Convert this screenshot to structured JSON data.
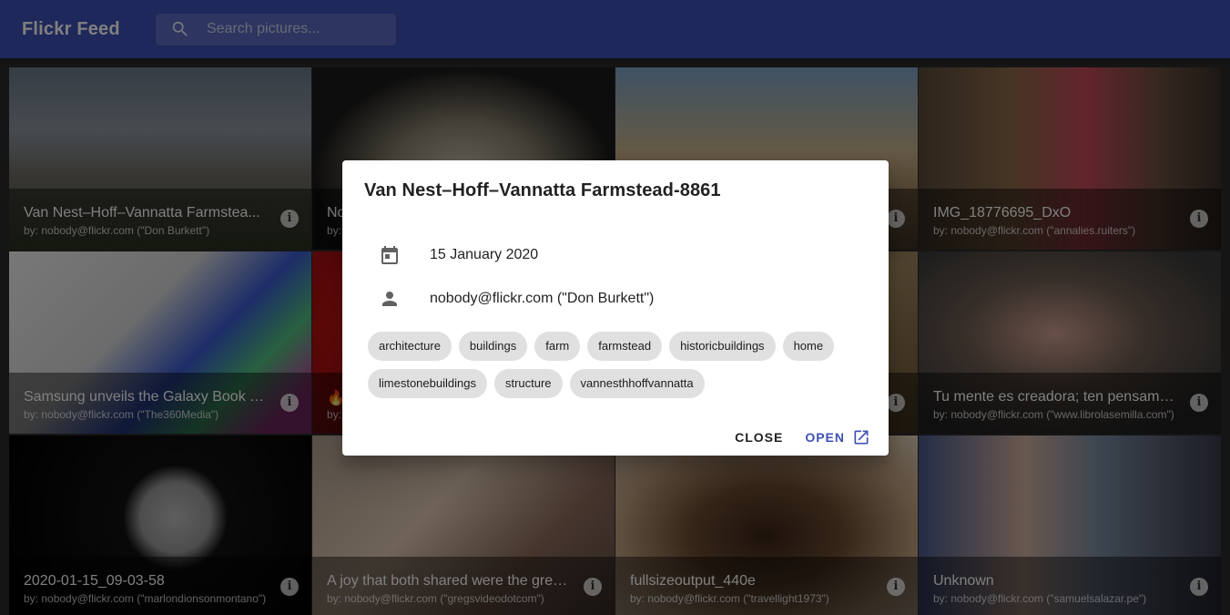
{
  "app": {
    "title": "Flickr Feed",
    "search_placeholder": "Search pictures...",
    "accent_color": "#3f51b5"
  },
  "tiles": [
    {
      "title": "Van Nest–Hoff–Vannatta Farmstea...",
      "author": "by: nobody@flickr.com (\"Don Burkett\")"
    },
    {
      "title": "No",
      "author": "by:"
    },
    {
      "title": "",
      "author": ""
    },
    {
      "title": "IMG_18776695_DxO",
      "author": "by: nobody@flickr.com (\"annalies.ruiters\")"
    },
    {
      "title": "Samsung unveils the Galaxy Book Fl...",
      "author": "by: nobody@flickr.com (\"The360Media\")"
    },
    {
      "title": "🔥",
      "author": "by:"
    },
    {
      "title": "",
      "author": ""
    },
    {
      "title": "Tu mente es creadora; ten pensami...",
      "author": "by: nobody@flickr.com (\"www.librolasemilla.com\")"
    },
    {
      "title": "2020-01-15_09-03-58",
      "author": "by: nobody@flickr.com (\"marlondionsonmontano\")"
    },
    {
      "title": "A joy that both shared were the grea...",
      "author": "by: nobody@flickr.com (\"gregsvideodotcom\")"
    },
    {
      "title": "fullsizeoutput_440e",
      "author": "by: nobody@flickr.com (\"travellight1973\")"
    },
    {
      "title": "Unknown",
      "author": "by: nobody@flickr.com (\"samuelsalazar.pe\")"
    }
  ],
  "dialog": {
    "title": "Van Nest–Hoff–Vannatta Farmstead-8861",
    "date": "15 January 2020",
    "author": "nobody@flickr.com (\"Don Burkett\")",
    "tags": [
      "architecture",
      "buildings",
      "farm",
      "farmstead",
      "historicbuildings",
      "home",
      "limestonebuildings",
      "structure",
      "vannesthhoffvannatta"
    ],
    "close_label": "CLOSE",
    "open_label": "OPEN"
  },
  "icons": {
    "search": "search-icon",
    "date": "calendar-icon",
    "author": "person-icon",
    "open": "open-in-new-icon",
    "info": "info-icon"
  }
}
